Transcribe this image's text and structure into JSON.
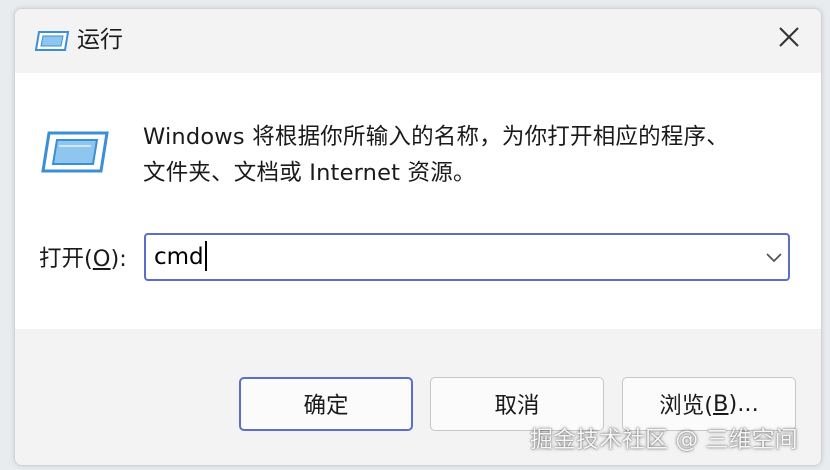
{
  "window": {
    "title": "运行",
    "icons": {
      "title_icon": "run-app-icon",
      "close_icon": "close-icon",
      "big_icon": "run-app-icon",
      "dropdown_icon": "chevron-down-icon"
    }
  },
  "content": {
    "description_line1": "Windows 将根据你所输入的名称，为你打开相应的程序、",
    "description_line2": "文件夹、文档或 Internet 资源。",
    "open_label_prefix": "打开(",
    "open_label_accel": "O",
    "open_label_suffix": "):",
    "open_input_value": "cmd"
  },
  "buttons": {
    "ok_label": "确定",
    "cancel_label": "取消",
    "browse_label_prefix": "浏览(",
    "browse_label_accel": "B",
    "browse_label_suffix": ")..."
  },
  "watermark": {
    "text": "掘金技术社区 @ 三维空间"
  },
  "colors": {
    "accent": "#5b6fc9",
    "titlebar_bg": "#f3f3f3",
    "footer_bg": "#f3f3f3",
    "icon_blue": "#3a8fd6"
  }
}
